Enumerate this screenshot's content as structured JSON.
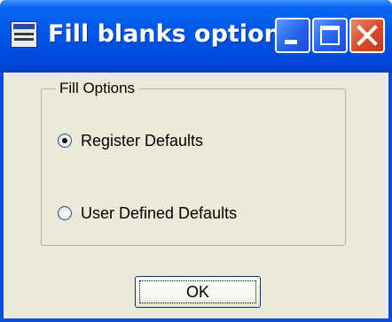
{
  "window": {
    "title": "Fill blanks option",
    "icon": "app-document-icon",
    "controls": [
      "minimize-icon",
      "maximize-icon",
      "close-icon"
    ]
  },
  "group": {
    "legend": "Fill Options"
  },
  "options": [
    {
      "label": "Register Defaults",
      "checked": true
    },
    {
      "label": "User Defined Defaults",
      "checked": false
    }
  ],
  "ok_button": {
    "label": "OK"
  },
  "colors": {
    "titlebar": "#0055e5",
    "client": "#ece9d8",
    "close_button": "#d5492c"
  }
}
